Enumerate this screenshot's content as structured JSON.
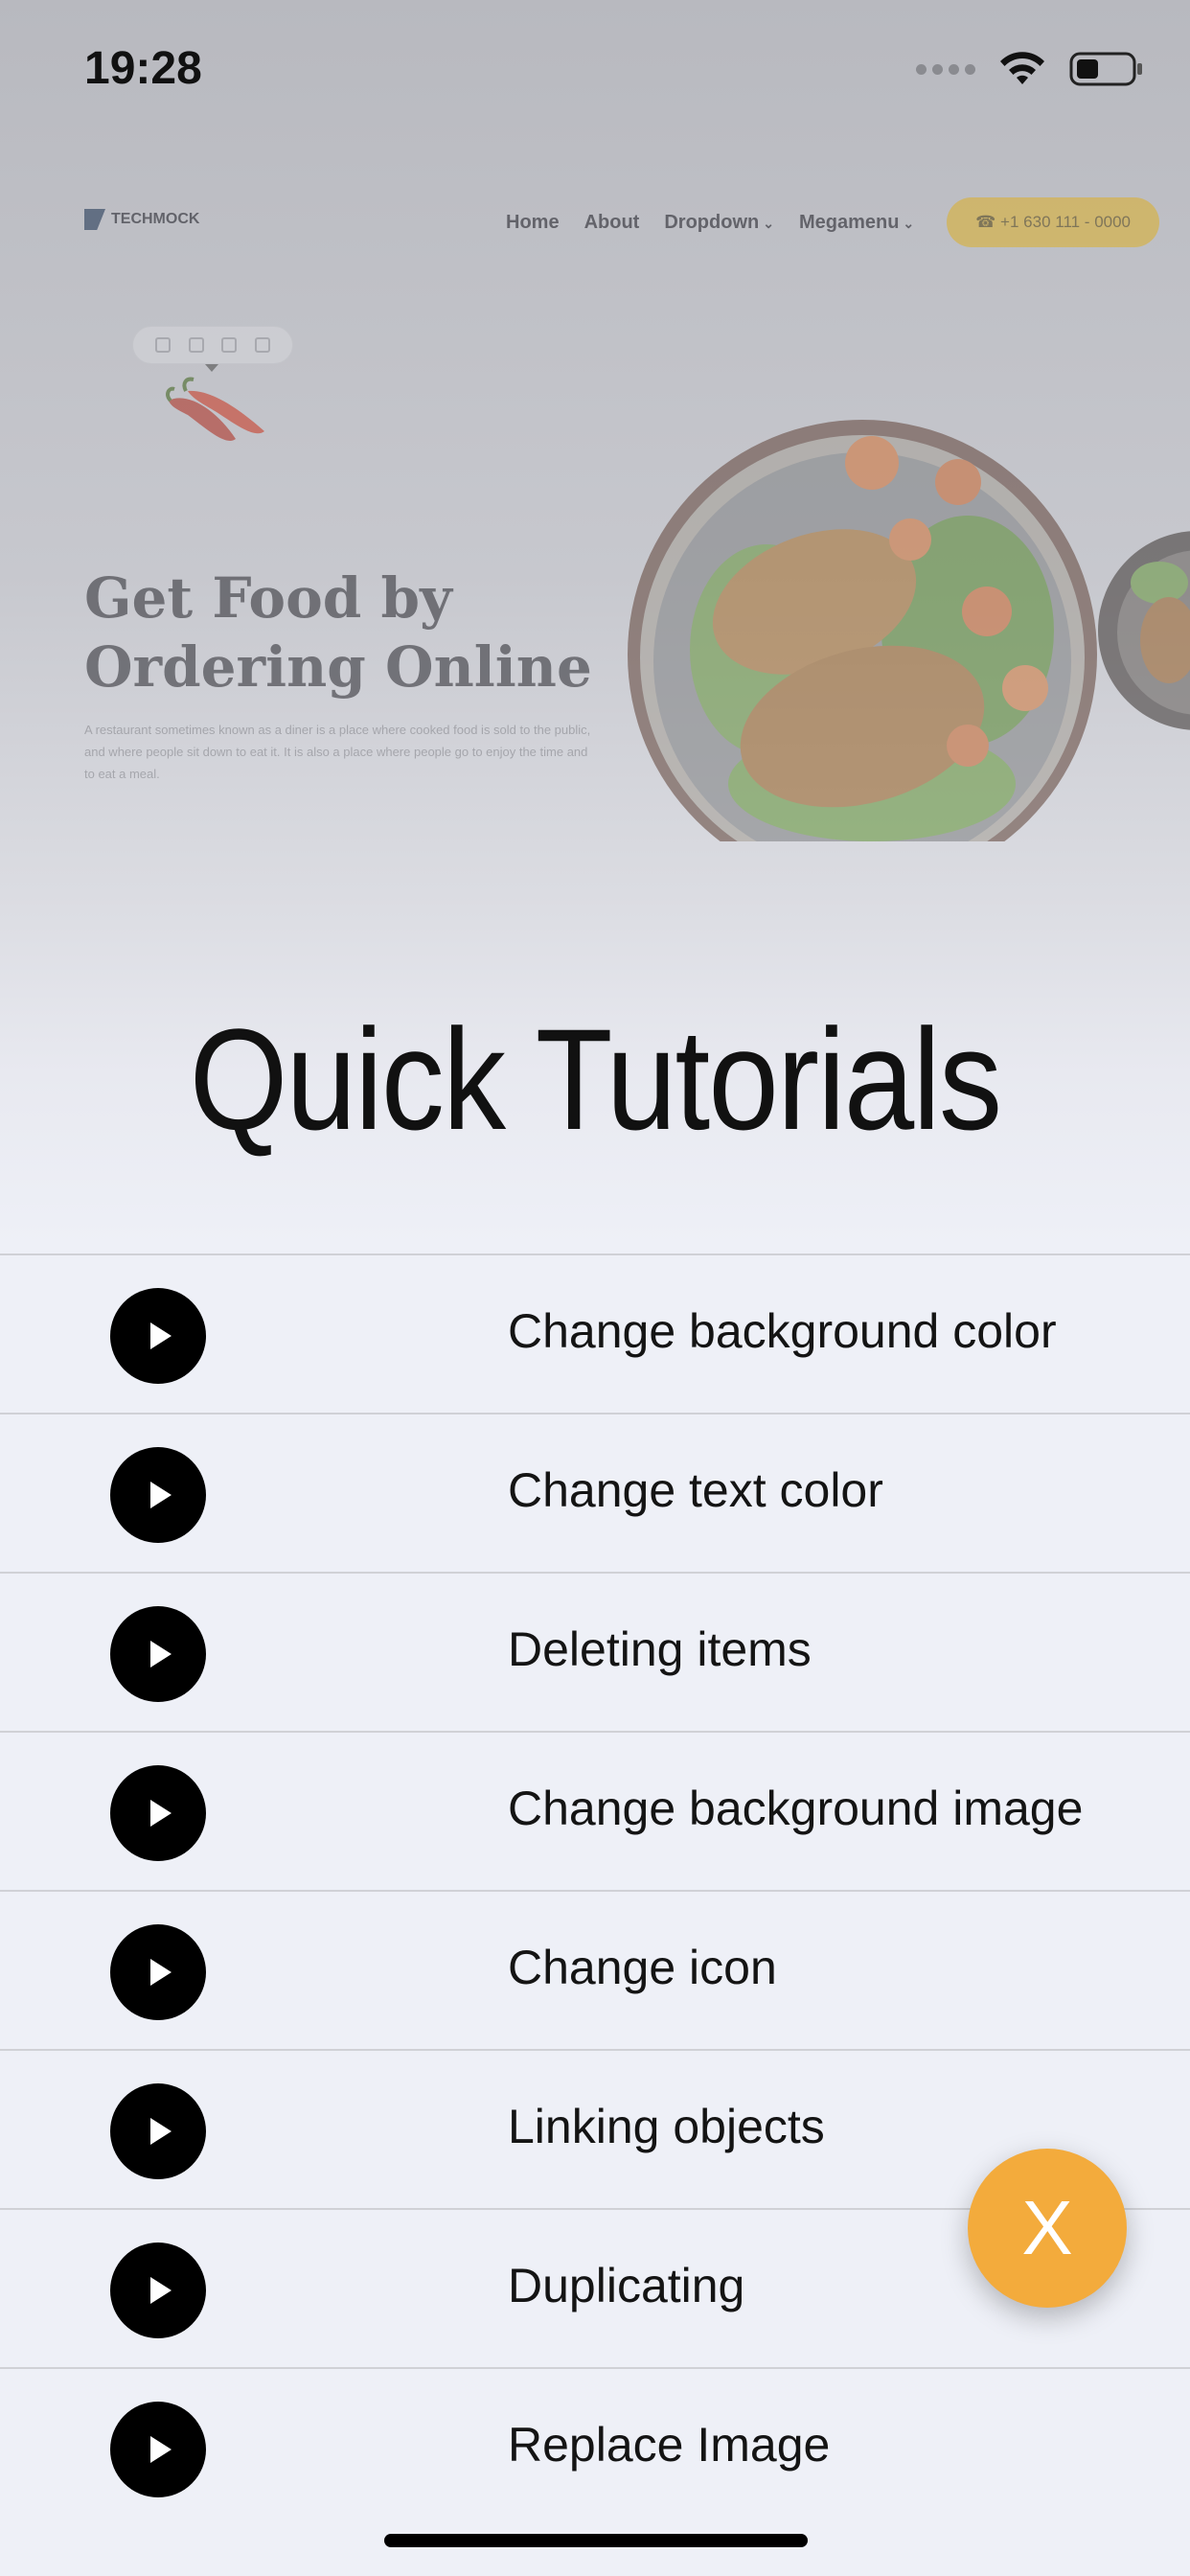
{
  "status_bar": {
    "time": "19:28"
  },
  "preview": {
    "logo_text": "TECHMOCK",
    "nav": {
      "items": [
        "Home",
        "About",
        "Dropdown",
        "Megamenu"
      ],
      "phone_button": "☎ +1 630 111 - 0000"
    },
    "hero": {
      "title_line1": "Get Food by",
      "title_line2": "Ordering Online",
      "text": "A restaurant sometimes known as a diner is a place where cooked food is sold to the public, and where people sit down to eat it. It is also a place where people go to enjoy the time and to eat a meal."
    }
  },
  "title": "Quick Tutorials",
  "tutorials": [
    {
      "label": "Change background color",
      "icon": "play-icon"
    },
    {
      "label": "Change text color",
      "icon": "play-icon"
    },
    {
      "label": "Deleting items",
      "icon": "play-icon"
    },
    {
      "label": "Change background image",
      "icon": "play-icon"
    },
    {
      "label": "Change icon",
      "icon": "play-icon"
    },
    {
      "label": "Linking objects",
      "icon": "play-icon"
    },
    {
      "label": "Duplicating",
      "icon": "play-icon"
    },
    {
      "label": "Replace Image",
      "icon": "play-icon"
    }
  ],
  "close_button": {
    "label": "X",
    "color": "#f3ab3c"
  },
  "colors": {
    "accent": "#f3ab3c",
    "phone_button": "#d9b13a",
    "list_background": "#eef0f7"
  }
}
